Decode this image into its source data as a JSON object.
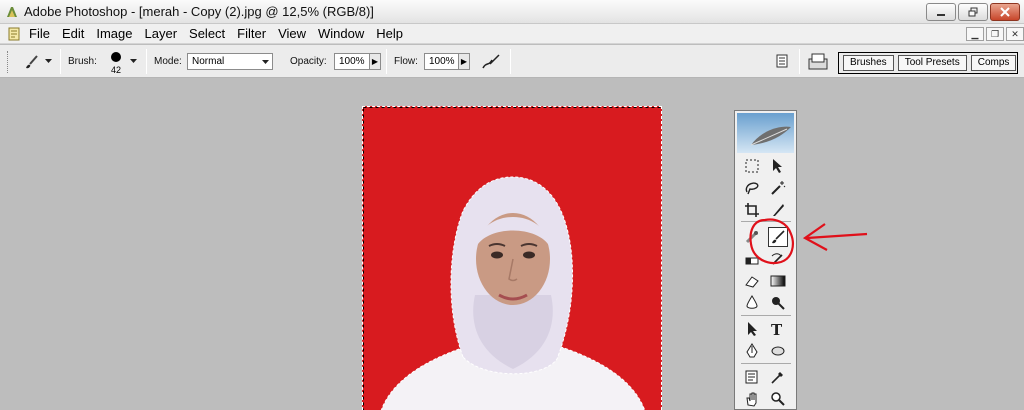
{
  "window": {
    "title": "Adobe Photoshop - [merah - Copy (2).jpg @ 12,5% (RGB/8)]"
  },
  "menu": {
    "items": [
      "File",
      "Edit",
      "Image",
      "Layer",
      "Select",
      "Filter",
      "View",
      "Window",
      "Help"
    ]
  },
  "options": {
    "brush_label": "Brush:",
    "brush_size": "42",
    "mode_label": "Mode:",
    "mode_value": "Normal",
    "opacity_label": "Opacity:",
    "opacity_value": "100%",
    "flow_label": "Flow:",
    "flow_value": "100%"
  },
  "panel_well": {
    "tabs": [
      "Brushes",
      "Tool Presets",
      "Comps"
    ]
  },
  "colors": {
    "document_background": "#d81b1f",
    "annotation": "#e0101a"
  },
  "icons": {
    "title": "photoshop-app-icon",
    "menu": "document-icon",
    "tool_preset": "brush-tool-icon"
  }
}
